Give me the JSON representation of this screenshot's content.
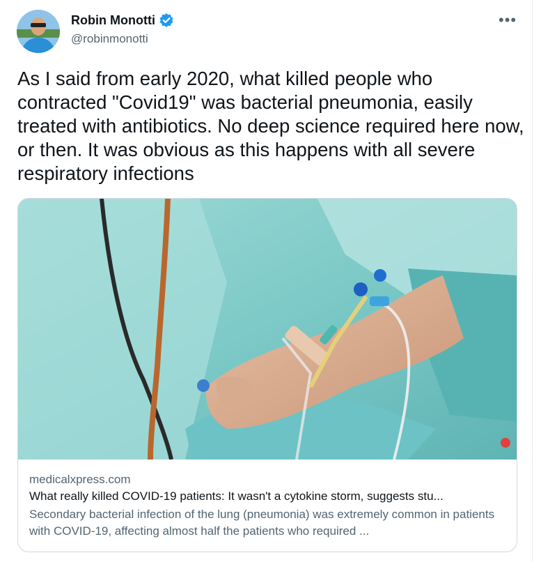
{
  "author": {
    "display_name": "Robin Monotti",
    "handle": "@robinmonotti",
    "verified": true,
    "avatar_icon": "profile-photo"
  },
  "more_label": "•••",
  "tweet": {
    "text": "As I said from early 2020, what killed people who contracted \"Covid19\" was bacterial pneumonia, easily treated with antibiotics. No deep science required here now, or then. It was obvious as this happens with all severe respiratory infections"
  },
  "link_card": {
    "domain": "medicalxpress.com",
    "title": "What really killed COVID-19 patients: It wasn't a cytokine storm, suggests stu...",
    "description": "Secondary bacterial infection of the lung (pneumonia) was extremely common in patients with COVID-19, affecting almost half the patients who required ..."
  },
  "colors": {
    "text_primary": "#0f1419",
    "text_secondary": "#536471",
    "verified_blue": "#1d9bf0",
    "border": "#cfd9de"
  }
}
